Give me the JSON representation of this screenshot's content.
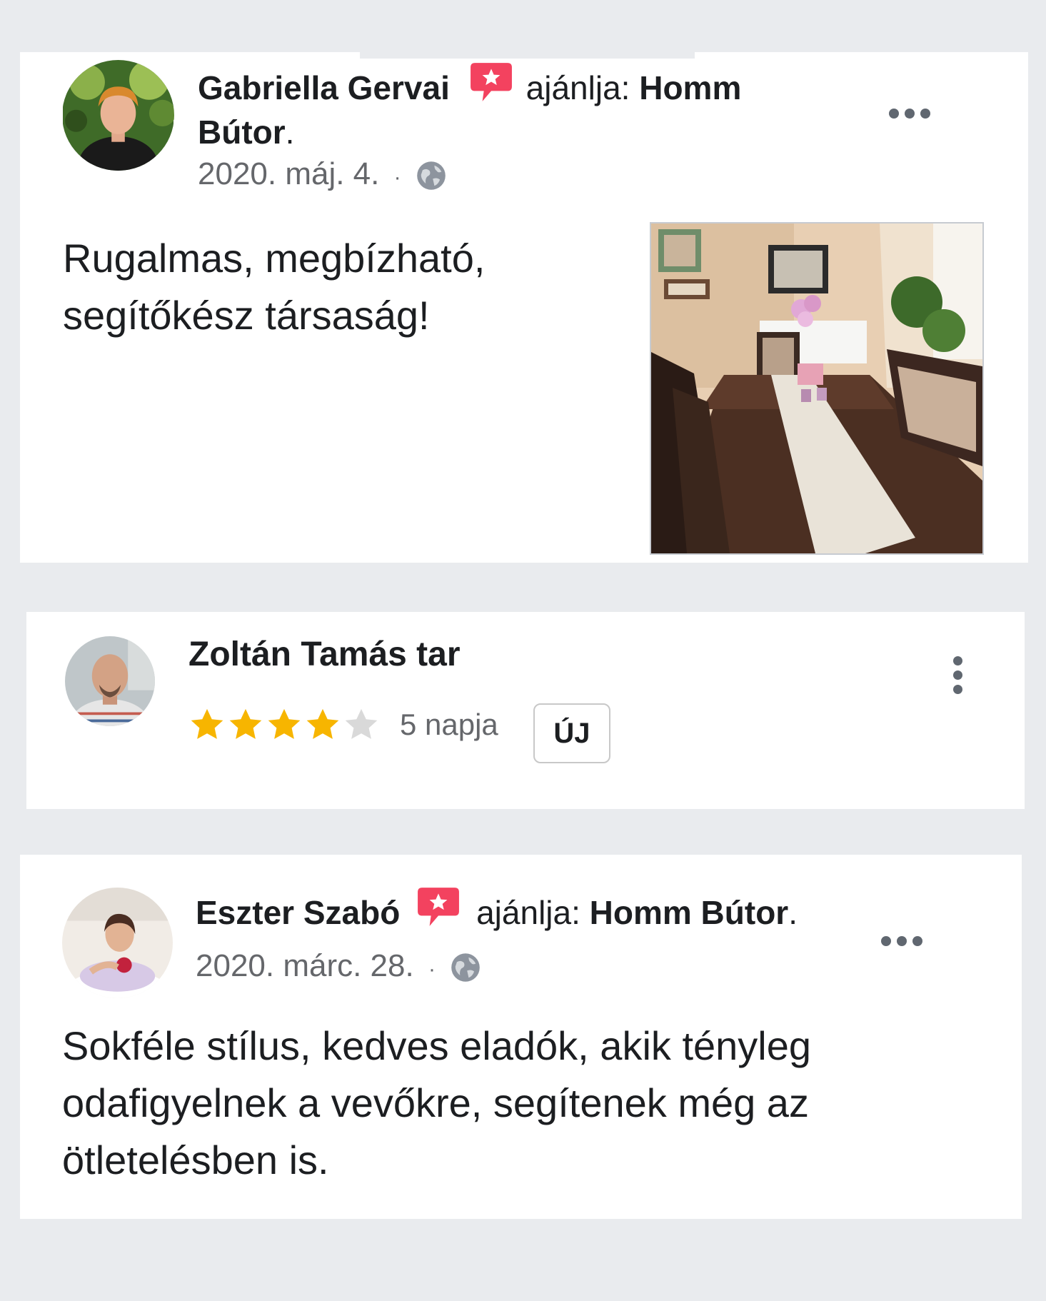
{
  "reviews": [
    {
      "author": "Gabriella Gervai",
      "recommends_label": "ajánlja:",
      "page_name_line1": "Homm",
      "page_name_line2": "Bútor",
      "period": ".",
      "date": "2020. máj. 4.",
      "separator": "·",
      "text": "Rugalmas, megbízható, segítőkész társaság!",
      "icons": {
        "badge": "recommendation-badge-icon",
        "privacy": "globe-icon",
        "menu": "more-options-icon"
      }
    },
    {
      "author": "Zoltán Tamás tar",
      "rating": 4,
      "rating_max": 5,
      "time_ago": "5 napja",
      "new_badge": "ÚJ",
      "icons": {
        "menu": "vertical-more-options-icon"
      }
    },
    {
      "author": "Eszter Szabó",
      "recommends_label": "ajánlja:",
      "page_name": "Homm Bútor",
      "period": ".",
      "date": "2020. márc. 28.",
      "separator": "·",
      "text": "Sokféle stílus, kedves eladók, akik tényleg odafigyelnek a vevőkre, segítenek még az ötletelésben is.",
      "icons": {
        "badge": "recommendation-badge-icon",
        "privacy": "globe-icon",
        "menu": "more-options-icon"
      }
    }
  ],
  "colors": {
    "page_bg": "#e9ebee",
    "card_bg": "#ffffff",
    "badge": "#f3425f",
    "star_filled": "#f7b500",
    "star_empty": "#d9d9d9",
    "muted_text": "#65676b"
  }
}
